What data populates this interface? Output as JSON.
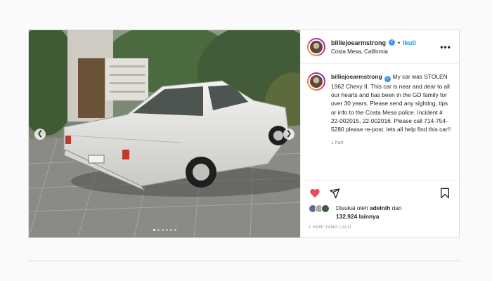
{
  "post": {
    "username": "billiejoearmstrong",
    "follow_label": "Ikuti",
    "location": "Costa Mesa, California",
    "separator": "•",
    "more_label": "•••",
    "caption": "My car was STOLEN 1962 Chevy II. This car is near and dear to all our hearts and has been in the GD family for over 30 years. Please send any sighting, tips or info to the Costa Mesa police. Incident # 22-002015, 22-002016. Please call 714-754-5280 please re-post. lets all help find this car!!",
    "caption_time": "1 hari",
    "liked_by_prefix": "Disukai oleh",
    "liked_by_user": "adelnih",
    "liked_by_join": "dan",
    "likes_count": "132,924 lainnya",
    "posted_ago": "1 HARI YANG LALU",
    "carousel": {
      "slides": 6,
      "active_index": 0
    },
    "icons": {
      "verified": "verified-badge-icon",
      "like": "heart-filled-icon",
      "share": "send-icon",
      "save": "bookmark-icon",
      "prev": "chevron-left-icon",
      "next": "chevron-right-icon"
    },
    "colors": {
      "like": "#ed4956",
      "link": "#0095f6",
      "verified": "#3897f0",
      "muted": "#8e8e8e"
    }
  }
}
